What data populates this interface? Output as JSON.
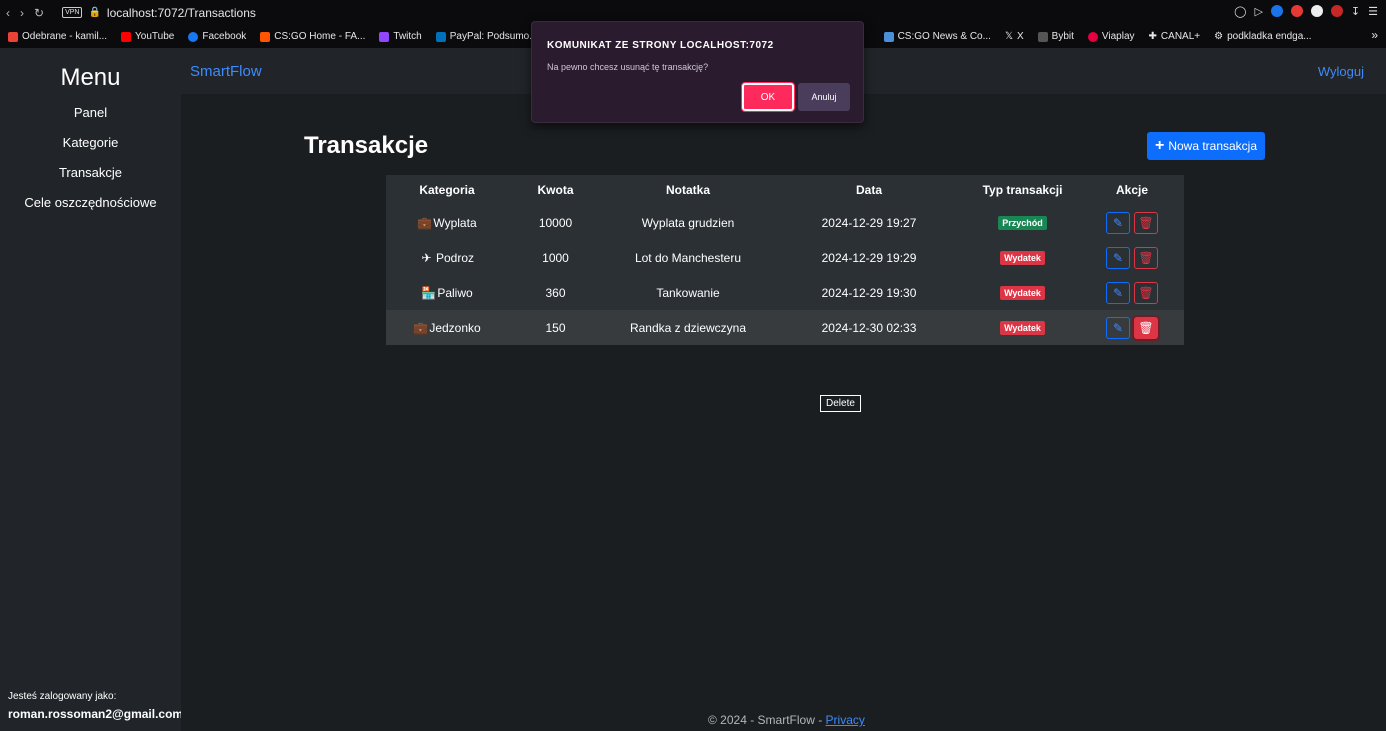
{
  "browser": {
    "url": "localhost:7072/Transactions",
    "vpn_label": "VPN",
    "bookmarks": [
      {
        "label": "Odebrane - kamil...",
        "color": "#ea4335"
      },
      {
        "label": "YouTube",
        "color": "#ff0000"
      },
      {
        "label": "Facebook",
        "color": "#1877f2"
      },
      {
        "label": "CS:GO Home - FA...",
        "color": "#ff5500"
      },
      {
        "label": "Twitch",
        "color": "#9146ff"
      },
      {
        "label": "PayPal: Podsumo...",
        "color": "#0070ba"
      },
      {
        "label": "CS:GO News & Co...",
        "color": "#4a90d9"
      },
      {
        "label": "X",
        "color": "#000000"
      },
      {
        "label": "Bybit",
        "color": "#888888"
      },
      {
        "label": "Viaplay",
        "color": "#e5003f"
      },
      {
        "label": "CANAL+",
        "color": "#444444"
      },
      {
        "label": "podkladka endga...",
        "color": "#777777"
      }
    ]
  },
  "sidebar": {
    "title": "Menu",
    "items": [
      "Panel",
      "Kategorie",
      "Transakcje",
      "Cele oszczędnościowe"
    ],
    "logged_label": "Jesteś zalogowany jako:",
    "logged_email": "roman.rossoman2@gmail.com"
  },
  "topnav": {
    "brand": "SmartFlow",
    "logout": "Wyloguj"
  },
  "page": {
    "title": "Transakcje",
    "new_button": "Nowa transakcja"
  },
  "table": {
    "headers": [
      "Kategoria",
      "Kwota",
      "Notatka",
      "Data",
      "Typ transakcji",
      "Akcje"
    ],
    "rows": [
      {
        "category": "Wyplata",
        "icon": "briefcase-icon",
        "amount": "10000",
        "note": "Wyplata grudzien",
        "date": "2024-12-29 19:27",
        "type": "Przychód"
      },
      {
        "category": "Podroz",
        "icon": "plane-icon",
        "amount": "1000",
        "note": "Lot do Manchesteru",
        "date": "2024-12-29 19:29",
        "type": "Wydatek"
      },
      {
        "category": "Paliwo",
        "icon": "store-icon",
        "amount": "360",
        "note": "Tankowanie",
        "date": "2024-12-29 19:30",
        "type": "Wydatek"
      },
      {
        "category": "Jedzonko",
        "icon": "briefcase-icon",
        "amount": "150",
        "note": "Randka z dziewczyna",
        "date": "2024-12-30 02:33",
        "type": "Wydatek"
      }
    ]
  },
  "tooltip": "Delete",
  "footer": {
    "text": "© 2024 - SmartFlow - ",
    "link": "Privacy"
  },
  "dialog": {
    "title": "KOMUNIKAT ZE STRONY LOCALHOST:7072",
    "message": "Na pewno chcesz usunąć tę transakcję?",
    "ok": "OK",
    "cancel": "Anuluj"
  },
  "colors": {
    "primary": "#0d6efd",
    "success": "#198754",
    "danger": "#dc3545",
    "dialog_ok": "#ff2a5c"
  }
}
